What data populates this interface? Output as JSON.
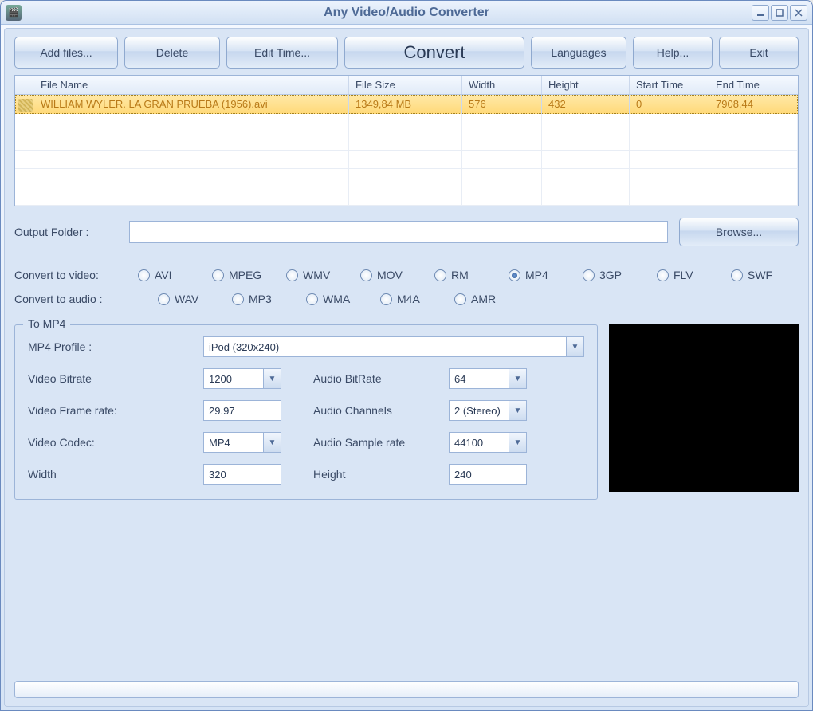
{
  "window": {
    "title": "Any Video/Audio Converter"
  },
  "toolbar": {
    "add_files": "Add files...",
    "delete": "Delete",
    "edit_time": "Edit Time...",
    "convert": "Convert",
    "languages": "Languages",
    "help": "Help...",
    "exit": "Exit"
  },
  "grid": {
    "cols": {
      "file_name": "File Name",
      "file_size": "File Size",
      "width": "Width",
      "height": "Height",
      "start_time": "Start Time",
      "end_time": "End Time"
    },
    "rows": [
      {
        "file_name": "WILLIAM WYLER. LA GRAN PRUEBA (1956).avi",
        "file_size": "1349,84 MB",
        "width": "576",
        "height": "432",
        "start_time": "0",
        "end_time": "7908,44"
      }
    ]
  },
  "output": {
    "label": "Output Folder :",
    "value": "",
    "browse": "Browse..."
  },
  "video_fmt": {
    "label": "Convert to video:",
    "opts": [
      "AVI",
      "MPEG",
      "WMV",
      "MOV",
      "RM",
      "MP4",
      "3GP",
      "FLV",
      "SWF"
    ],
    "selected": "MP4"
  },
  "audio_fmt": {
    "label": "Convert to audio :",
    "opts": [
      "WAV",
      "MP3",
      "WMA",
      "M4A",
      "AMR"
    ],
    "selected": ""
  },
  "settings": {
    "legend": "To MP4",
    "profile_label": "MP4 Profile :",
    "profile_value": "iPod (320x240)",
    "vbitrate_label": "Video Bitrate",
    "vbitrate_value": "1200",
    "abitrate_label": "Audio BitRate",
    "abitrate_value": "64",
    "vframerate_label": "Video Frame rate:",
    "vframerate_value": "29.97",
    "achannels_label": "Audio Channels",
    "achannels_value": "2 (Stereo)",
    "vcodec_label": "Video Codec:",
    "vcodec_value": "MP4",
    "asample_label": "Audio Sample rate",
    "asample_value": "44100",
    "width_label": "Width",
    "width_value": "320",
    "height_label": "Height",
    "height_value": "240"
  }
}
